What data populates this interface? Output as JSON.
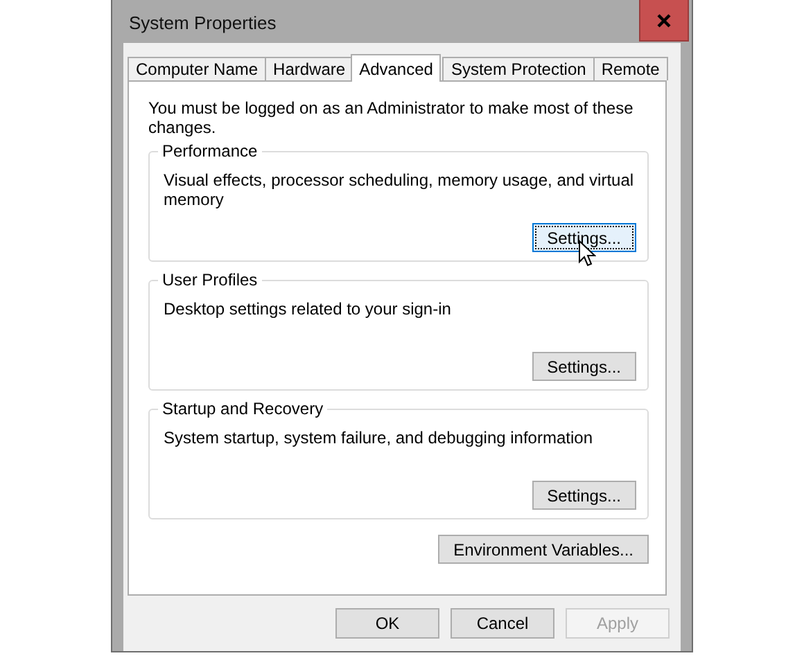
{
  "window": {
    "title": "System Properties"
  },
  "tabs": [
    {
      "label": "Computer Name",
      "selected": false
    },
    {
      "label": "Hardware",
      "selected": false
    },
    {
      "label": "Advanced",
      "selected": true
    },
    {
      "label": "System Protection",
      "selected": false
    },
    {
      "label": "Remote",
      "selected": false
    }
  ],
  "notice": "You must be logged on as an Administrator to make most of these changes.",
  "groups": [
    {
      "title": "Performance",
      "description": "Visual effects, processor scheduling, memory usage, and virtual memory",
      "button": {
        "label": "Settings...",
        "hovered": true
      }
    },
    {
      "title": "User Profiles",
      "description": "Desktop settings related to your sign-in",
      "button": {
        "label": "Settings...",
        "hovered": false
      }
    },
    {
      "title": "Startup and Recovery",
      "description": "System startup, system failure, and debugging information",
      "button": {
        "label": "Settings...",
        "hovered": false
      }
    }
  ],
  "environment_button": {
    "label": "Environment Variables..."
  },
  "dialog_buttons": [
    {
      "label": "OK",
      "disabled": false
    },
    {
      "label": "Cancel",
      "disabled": false
    },
    {
      "label": "Apply",
      "disabled": true
    }
  ]
}
